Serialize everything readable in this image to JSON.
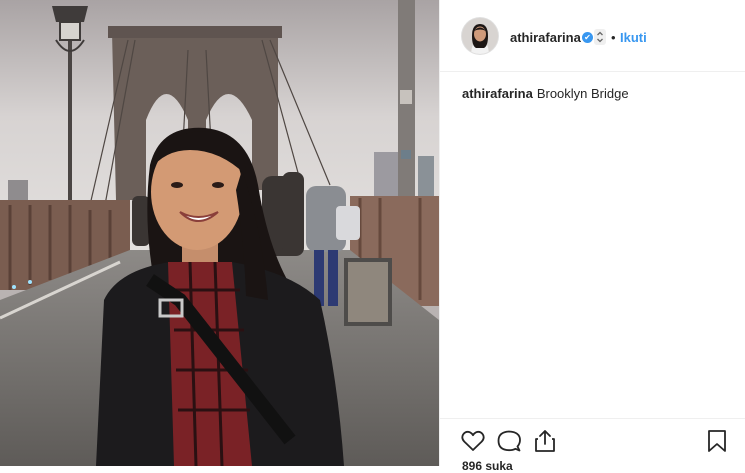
{
  "post": {
    "username": "athirafarina",
    "follow_label": "Ikuti",
    "separator": "•",
    "caption_user": "athirafarina",
    "caption_text": "Brooklyn Bridge",
    "likes_text": "896 suka"
  },
  "icons": {
    "verified": "✔",
    "options": "⌃⌄",
    "like": "heart-icon",
    "comment": "comment-icon",
    "share": "share-icon",
    "save": "bookmark-icon"
  },
  "colors": {
    "accent": "#3897f0",
    "text": "#262626",
    "divider": "#efefef"
  }
}
